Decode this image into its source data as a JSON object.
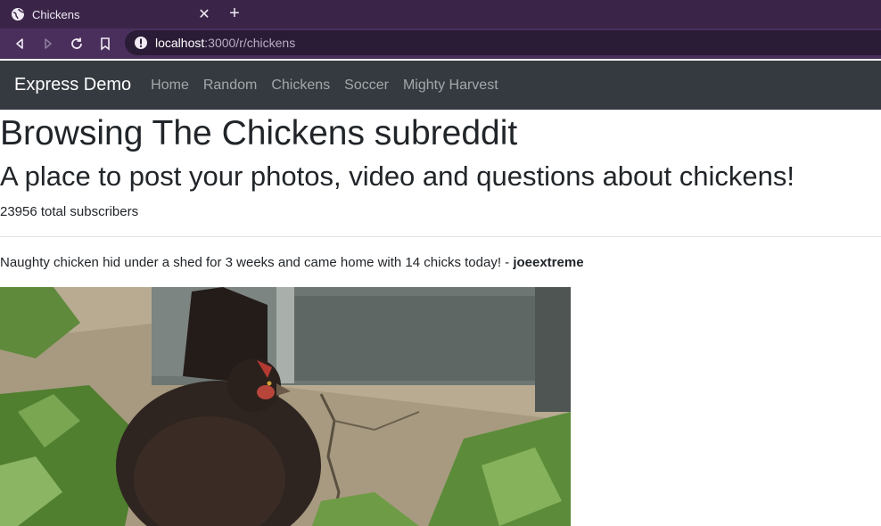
{
  "browser": {
    "tab_title": "Chickens",
    "url_host": "localhost",
    "url_path": ":3000/r/chickens"
  },
  "navbar": {
    "brand": "Express Demo",
    "links": [
      "Home",
      "Random",
      "Chickens",
      "Soccer",
      "Mighty Harvest"
    ]
  },
  "page": {
    "title": "Browsing The Chickens subreddit",
    "subtitle": "A place to post your photos, video and questions about chickens!",
    "subscribers": "23956 total subscribers"
  },
  "post": {
    "title": "Naughty chicken hid under a shed for 3 weeks and came home with 14 chicks today!",
    "separator": " - ",
    "author": "joeextreme"
  },
  "colors": {
    "tab_strip": "#3a2548",
    "toolbar": "#4a2f5c",
    "app_navbar": "#343a40"
  }
}
